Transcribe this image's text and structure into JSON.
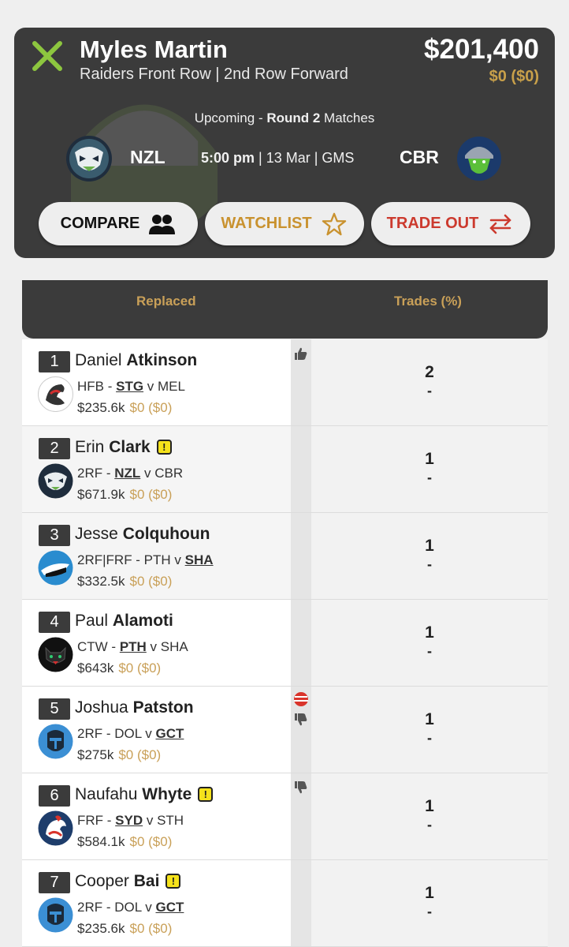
{
  "player": {
    "first_name": "Myles",
    "last_name": "Martin",
    "full_name": "Myles Martin",
    "subtitle": "Raiders Front Row | 2nd Row Forward",
    "price": "$201,400",
    "price_change": "$0  ($0)"
  },
  "fixture": {
    "upcoming_prefix": "Upcoming - ",
    "round_label": "Round 2",
    "upcoming_suffix": " Matches",
    "home_team": "NZL",
    "away_team": "CBR",
    "time": "5:00 pm",
    "details": " | 13 Mar | GMS"
  },
  "actions": {
    "compare": "COMPARE",
    "watchlist": "WATCHLIST",
    "trade_out": "TRADE OUT"
  },
  "table": {
    "col_replaced": "Replaced",
    "col_trades": "Trades (%)"
  },
  "rows": [
    {
      "rank": "1",
      "first": "Daniel",
      "last": "Atkinson",
      "warning": false,
      "pos": "HFB - ",
      "team": "STG",
      "vs": " v MEL",
      "home_highlight": true,
      "price": "$235.6k",
      "change": "$0 ($0)",
      "trades": "2",
      "pct": "-",
      "logo": "dragons"
    },
    {
      "rank": "2",
      "first": "Erin",
      "last": "Clark",
      "warning": true,
      "pos": "2RF - ",
      "team": "NZL",
      "vs": " v CBR",
      "home_highlight": true,
      "price": "$671.9k",
      "change": "$0 ($0)",
      "trades": "1",
      "pct": "-",
      "logo": "warriors"
    },
    {
      "rank": "3",
      "first": "Jesse",
      "last": "Colquhoun",
      "warning": false,
      "pos": "2RF|FRF - PTH v ",
      "team": "SHA",
      "vs": "",
      "home_highlight": false,
      "price": "$332.5k",
      "change": "$0 ($0)",
      "trades": "1",
      "pct": "-",
      "logo": "sharks"
    },
    {
      "rank": "4",
      "first": "Paul",
      "last": "Alamoti",
      "warning": false,
      "pos": "CTW - ",
      "team": "PTH",
      "vs": " v SHA",
      "home_highlight": true,
      "price": "$643k",
      "change": "$0 ($0)",
      "trades": "1",
      "pct": "-",
      "logo": "panthers"
    },
    {
      "rank": "5",
      "first": "Joshua",
      "last": "Patston",
      "warning": false,
      "pos": "2RF - DOL v ",
      "team": "GCT",
      "vs": "",
      "home_highlight": false,
      "price": "$275k",
      "change": "$0 ($0)",
      "trades": "1",
      "pct": "-",
      "logo": "titans"
    },
    {
      "rank": "6",
      "first": "Naufahu",
      "last": "Whyte",
      "warning": true,
      "pos": "FRF - ",
      "team": "SYD",
      "vs": " v STH",
      "home_highlight": true,
      "price": "$584.1k",
      "change": "$0 ($0)",
      "trades": "1",
      "pct": "-",
      "logo": "roosters"
    },
    {
      "rank": "7",
      "first": "Cooper",
      "last": "Bai",
      "warning": true,
      "pos": "2RF - DOL v ",
      "team": "GCT",
      "vs": "",
      "home_highlight": false,
      "price": "$235.6k",
      "change": "$0 ($0)",
      "trades": "1",
      "pct": "-",
      "logo": "titans"
    }
  ],
  "warning_glyph": "!",
  "icons": [
    "close-icon",
    "compare-users-icon",
    "star-icon",
    "swap-arrows-icon",
    "thumbs-up-icon",
    "thumbs-down-icon",
    "injury-stripes-icon"
  ],
  "colors": {
    "accent_gold": "#c9a058",
    "trade_red": "#cc3a2e",
    "card_dark": "#3b3b3b",
    "watch_gold": "#c9922f",
    "close_green": "#8dc63f"
  }
}
